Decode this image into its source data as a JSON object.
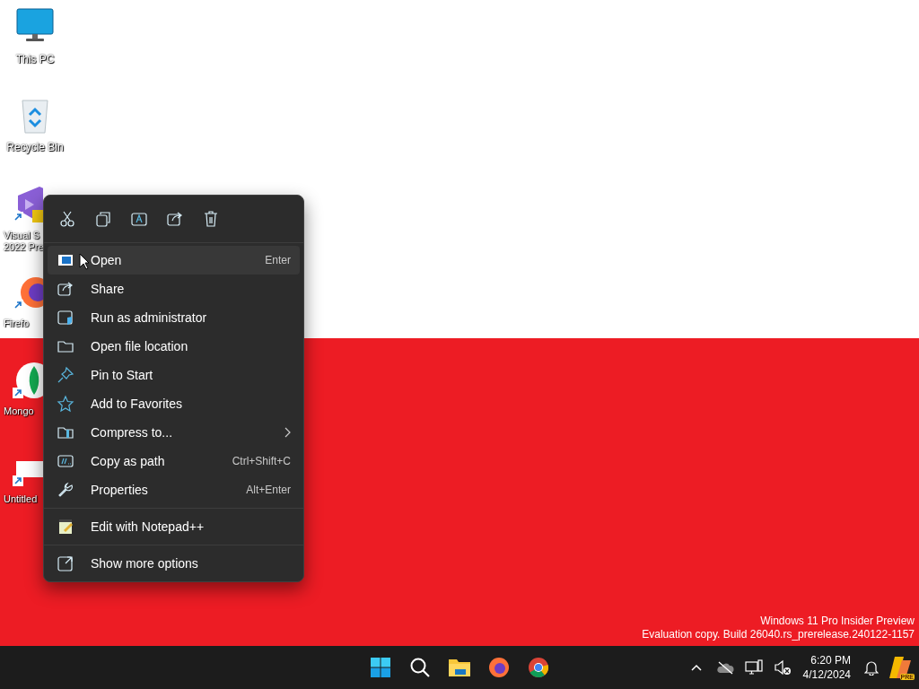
{
  "desktop_icons": [
    {
      "kind": "pc",
      "label_lines": [
        "This PC"
      ],
      "covered": false
    },
    {
      "kind": "bin",
      "label_lines": [
        "Recycle Bin"
      ],
      "covered": false
    },
    {
      "kind": "vs",
      "label_lines": [
        "Visual S",
        "2022 Pre"
      ],
      "covered": true
    },
    {
      "kind": "firefox",
      "label_lines": [
        "Firefo"
      ],
      "covered": true
    },
    {
      "kind": "mongo",
      "label_lines": [
        "Mongo"
      ],
      "covered": true
    },
    {
      "kind": "file",
      "label_lines": [
        "Untitled"
      ],
      "covered": true
    }
  ],
  "context_menu": {
    "groups": [
      [
        {
          "kind": "open",
          "label": "Open",
          "shortcut": "Enter",
          "submenu": false,
          "selected": true
        },
        {
          "kind": "share",
          "label": "Share",
          "submenu": false,
          "selected": false
        },
        {
          "kind": "admin",
          "label": "Run as administrator",
          "submenu": false,
          "selected": false
        },
        {
          "kind": "folder",
          "label": "Open file location",
          "submenu": false,
          "selected": false
        },
        {
          "kind": "pin",
          "label": "Pin to Start",
          "submenu": false,
          "selected": false
        },
        {
          "kind": "star",
          "label": "Add to Favorites",
          "submenu": false,
          "selected": false
        },
        {
          "kind": "zip",
          "label": "Compress to...",
          "submenu": true,
          "selected": false
        },
        {
          "kind": "path",
          "label": "Copy as path",
          "shortcut": "Ctrl+Shift+C",
          "submenu": false,
          "selected": false
        },
        {
          "kind": "wrench",
          "label": "Properties",
          "shortcut": "Alt+Enter",
          "submenu": false,
          "selected": false
        }
      ],
      [
        {
          "kind": "notepad",
          "label": "Edit with Notepad++",
          "submenu": false,
          "selected": false
        }
      ],
      [
        {
          "kind": "more",
          "label": "Show more options",
          "submenu": false,
          "selected": false
        }
      ]
    ]
  },
  "watermark": [
    "Windows 11 Pro Insider Preview",
    "Evaluation copy. Build 26040.rs_prerelease.240122-1157"
  ],
  "taskbar": {
    "time": "6:20 PM",
    "date": "4/12/2024",
    "copilot_badge": "PRE"
  }
}
